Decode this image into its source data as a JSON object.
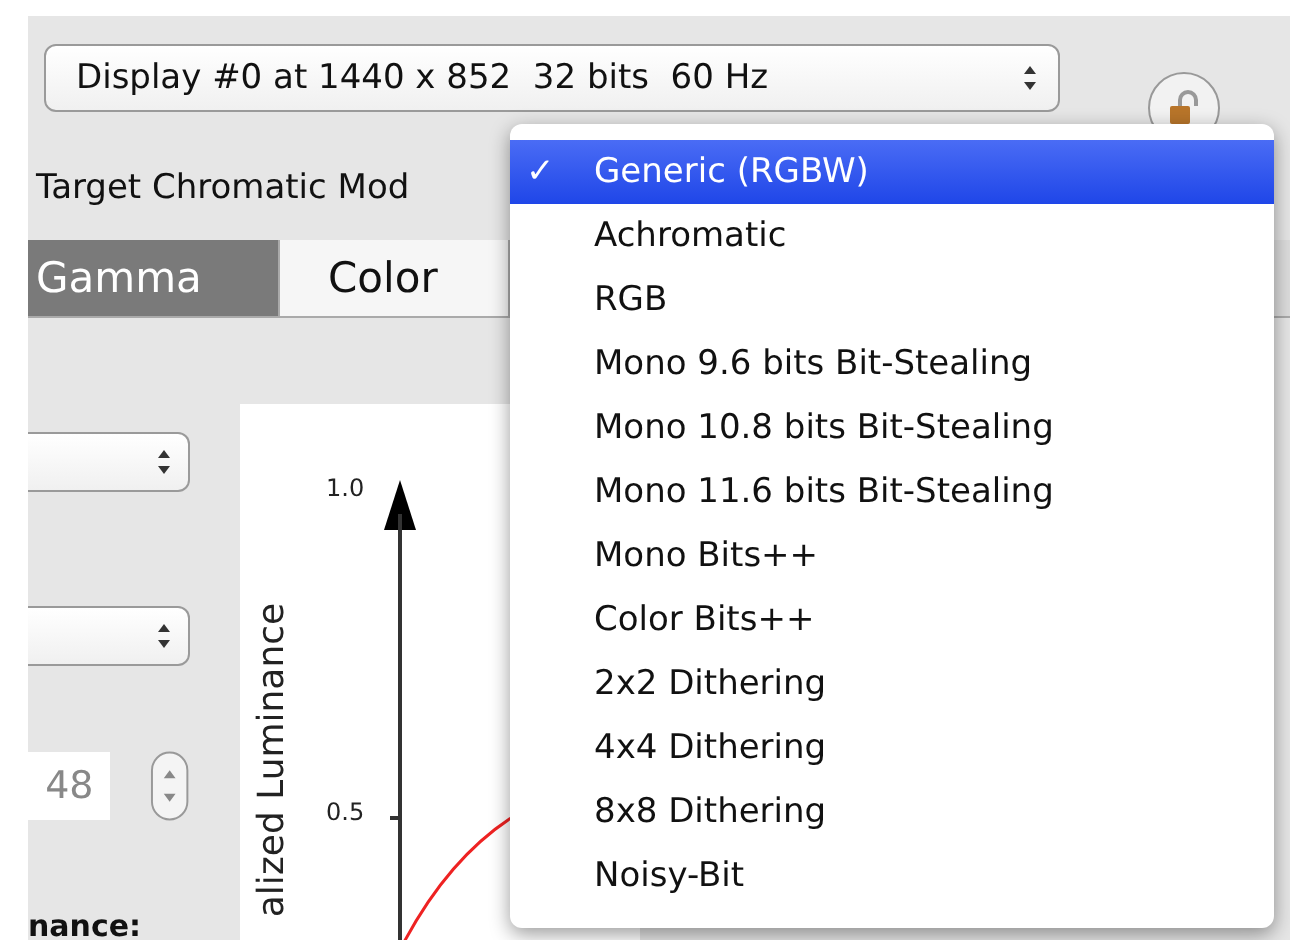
{
  "display_popup": {
    "value": "Display #0 at 1440 x 852  32 bits  60 Hz"
  },
  "target_label": "Target Chromatic Mod",
  "tabs": [
    {
      "label": "Gamma",
      "selected": true
    },
    {
      "label": "Color",
      "selected": false
    }
  ],
  "left_panel": {
    "field_value": "48",
    "label": "nance:"
  },
  "plot": {
    "axis_label": "alized Luminance",
    "ticks": [
      "1.0",
      "0.5"
    ]
  },
  "menu": {
    "check_mark": "✓",
    "items": [
      {
        "label": "Generic (RGBW)",
        "selected": true
      },
      {
        "label": "Achromatic",
        "selected": false
      },
      {
        "label": "RGB",
        "selected": false
      },
      {
        "label": "Mono 9.6 bits Bit-Stealing",
        "selected": false
      },
      {
        "label": "Mono 10.8 bits Bit-Stealing",
        "selected": false
      },
      {
        "label": "Mono 11.6 bits Bit-Stealing",
        "selected": false
      },
      {
        "label": "Mono Bits++",
        "selected": false
      },
      {
        "label": "Color Bits++",
        "selected": false
      },
      {
        "label": "2x2 Dithering",
        "selected": false
      },
      {
        "label": "4x4 Dithering",
        "selected": false
      },
      {
        "label": "8x8 Dithering",
        "selected": false
      },
      {
        "label": "Noisy-Bit",
        "selected": false
      }
    ]
  }
}
